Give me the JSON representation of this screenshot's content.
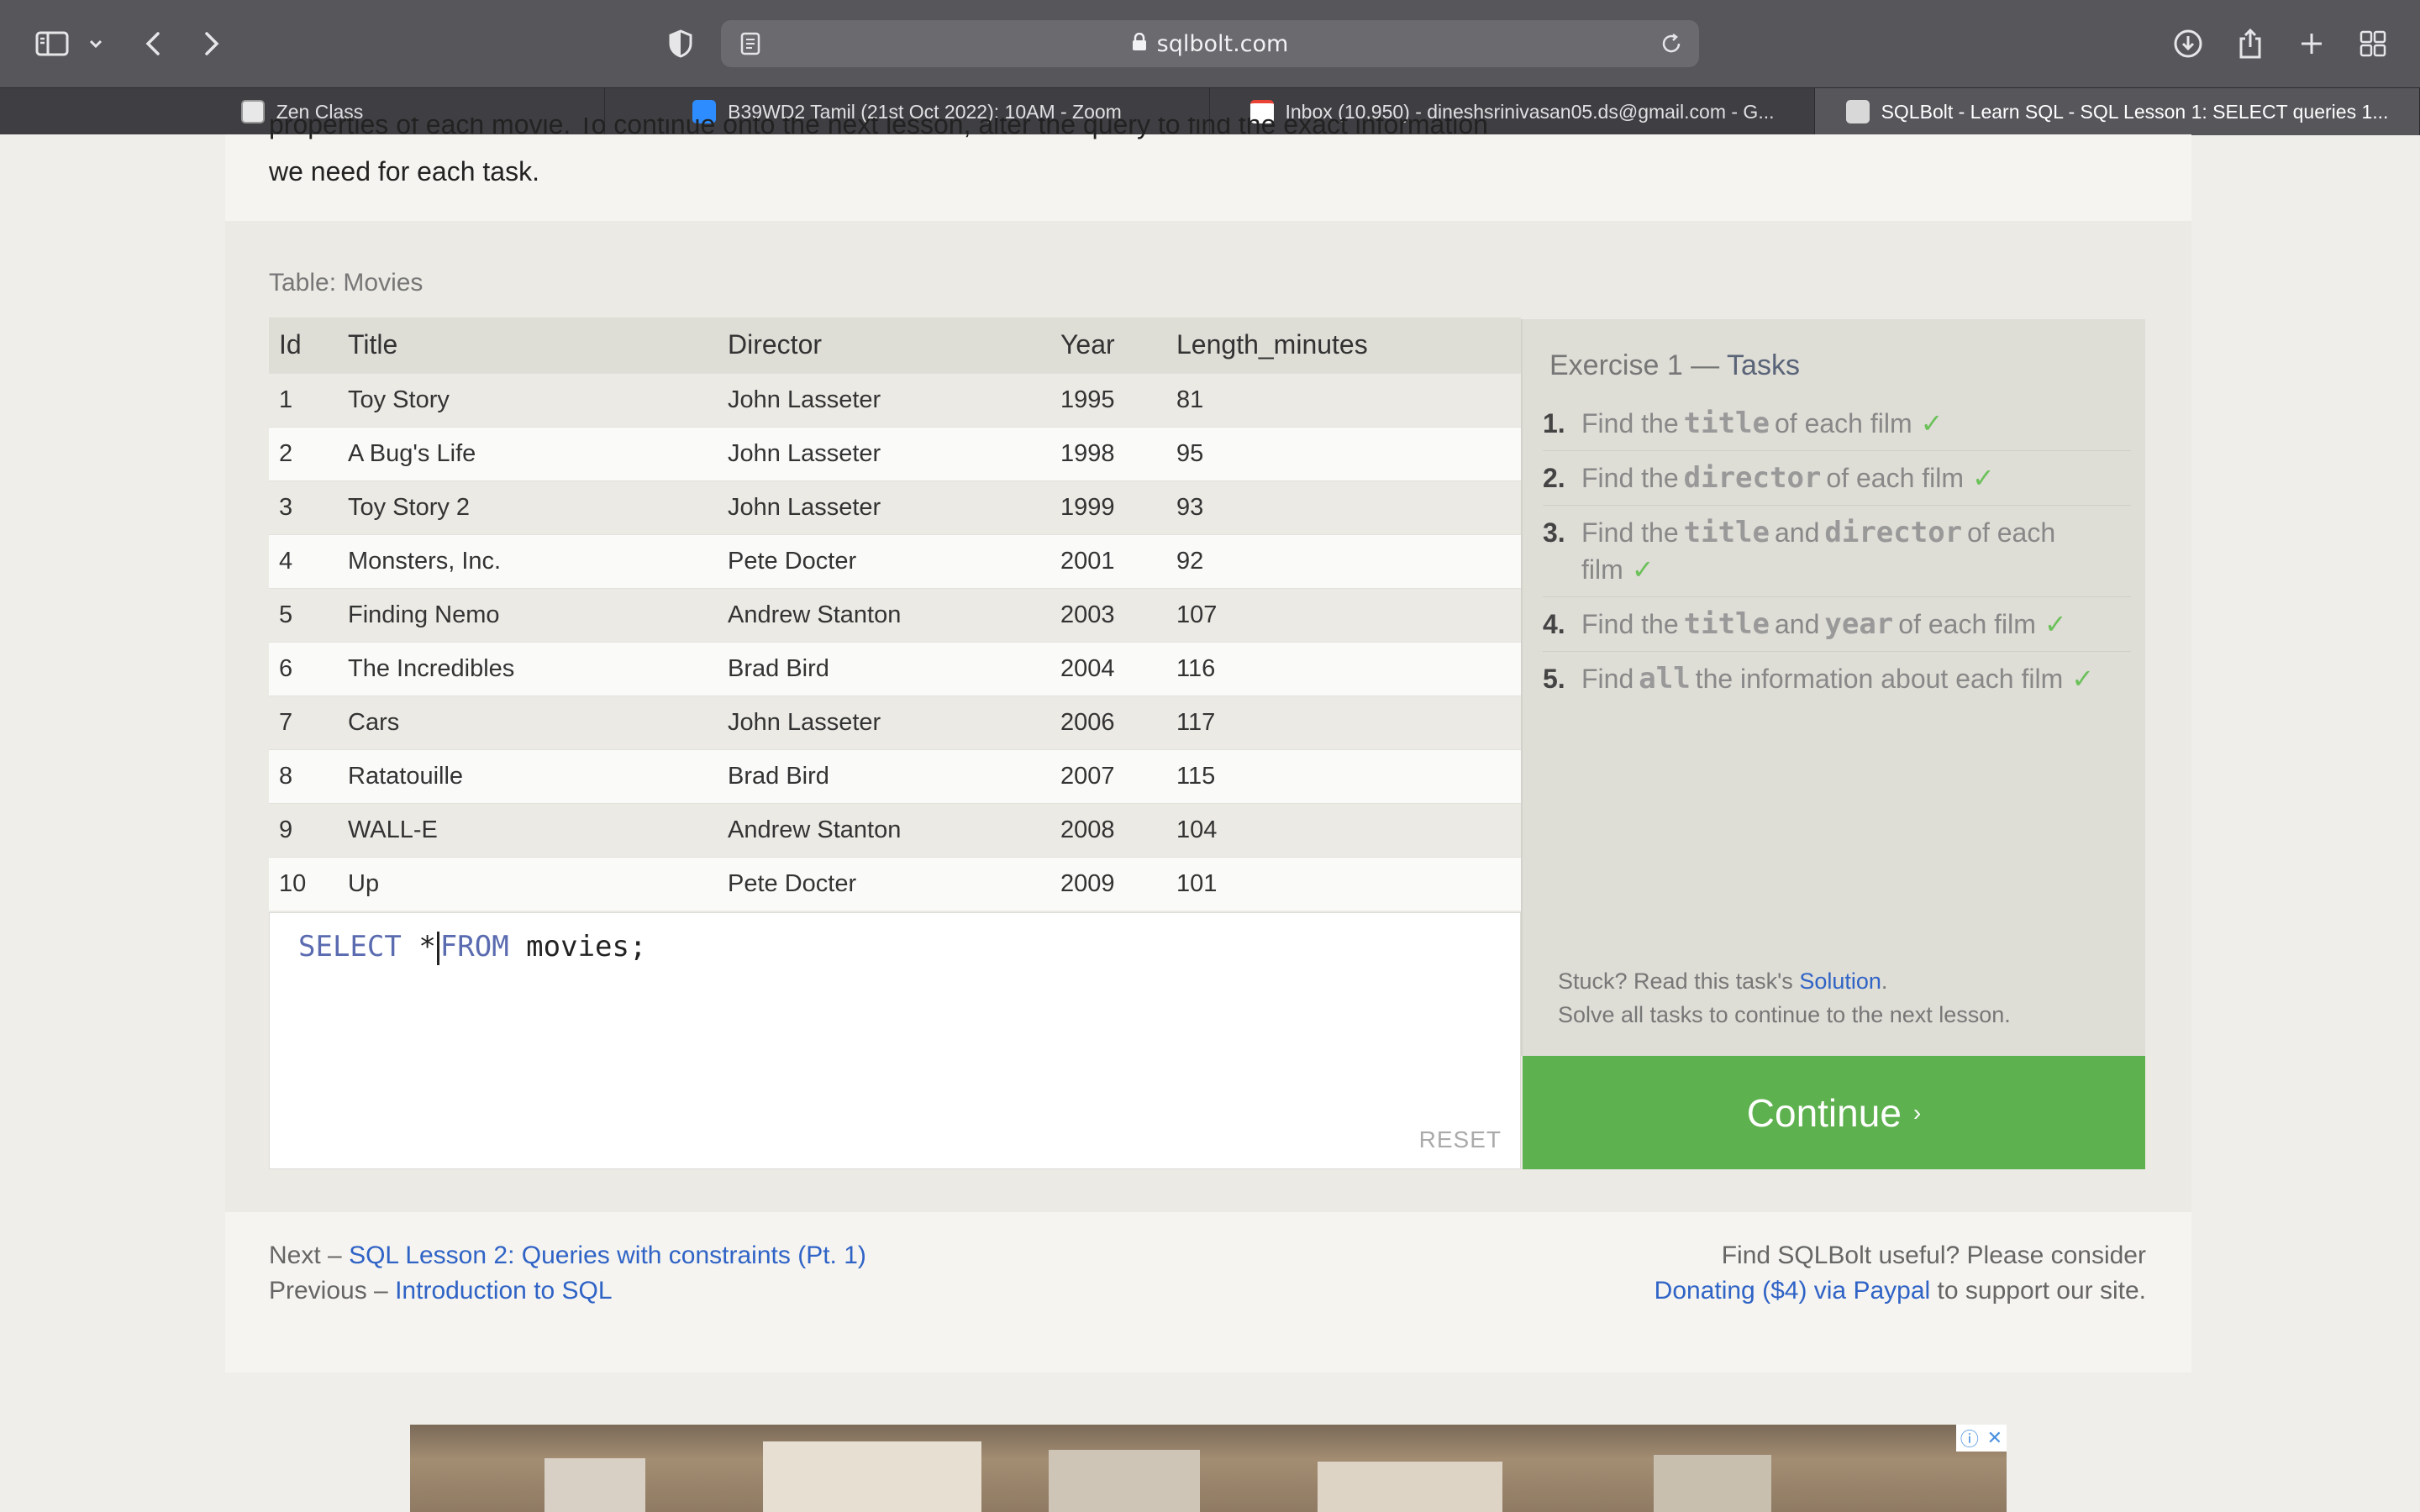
{
  "browser": {
    "url": "sqlbolt.com",
    "tabs": [
      {
        "label": "Zen Class",
        "icon": "zen-class-favicon"
      },
      {
        "label": "B39WD2 Tamil (21st Oct 2022): 10AM - Zoom",
        "icon": "zoom-favicon"
      },
      {
        "label": "Inbox (10,950) - dineshsrinivasan05.ds@gmail.com - G...",
        "icon": "gmail-favicon"
      },
      {
        "label": "SQLBolt - Learn SQL - SQL Lesson 1: SELECT queries 1...",
        "icon": "sqlbolt-favicon",
        "active": true
      }
    ]
  },
  "intro": {
    "clipped_line": "properties of each movie. To continue onto the next lesson, alter the query to find the exact information",
    "last_line": "we need for each task."
  },
  "table": {
    "caption": "Table: Movies",
    "columns": [
      "Id",
      "Title",
      "Director",
      "Year",
      "Length_minutes"
    ],
    "rows": [
      [
        "1",
        "Toy Story",
        "John Lasseter",
        "1995",
        "81"
      ],
      [
        "2",
        "A Bug's Life",
        "John Lasseter",
        "1998",
        "95"
      ],
      [
        "3",
        "Toy Story 2",
        "John Lasseter",
        "1999",
        "93"
      ],
      [
        "4",
        "Monsters, Inc.",
        "Pete Docter",
        "2001",
        "92"
      ],
      [
        "5",
        "Finding Nemo",
        "Andrew Stanton",
        "2003",
        "107"
      ],
      [
        "6",
        "The Incredibles",
        "Brad Bird",
        "2004",
        "116"
      ],
      [
        "7",
        "Cars",
        "John Lasseter",
        "2006",
        "117"
      ],
      [
        "8",
        "Ratatouille",
        "Brad Bird",
        "2007",
        "115"
      ],
      [
        "9",
        "WALL-E",
        "Andrew Stanton",
        "2008",
        "104"
      ],
      [
        "10",
        "Up",
        "Pete Docter",
        "2009",
        "101"
      ]
    ]
  },
  "editor": {
    "kw_select": "SELECT",
    "star": "*",
    "kw_from": "FROM",
    "rest": "movies;",
    "reset_label": "RESET"
  },
  "tasks": {
    "title_prefix": "Exercise 1 —",
    "title_suffix": "Tasks",
    "items": [
      {
        "num": "1.",
        "pre": "Find the",
        "code": "title",
        "post": "of each film",
        "done": true
      },
      {
        "num": "2.",
        "pre": "Find the",
        "code": "director",
        "post": "of each film",
        "done": true
      },
      {
        "num": "3.",
        "pre": "Find the",
        "code": "title",
        "mid": "and",
        "code2": "director",
        "post": "of each film",
        "done": true
      },
      {
        "num": "4.",
        "pre": "Find the",
        "code": "title",
        "mid": "and",
        "code2": "year",
        "post": "of each film",
        "done": true
      },
      {
        "num": "5.",
        "pre": "Find",
        "code": "all",
        "post": "the information about each film",
        "done": true
      }
    ],
    "check_mark": "✓",
    "stuck_text": "Stuck? Read this task's",
    "solution_link": "Solution",
    "solve_all_text": "Solve all tasks to continue to the next lesson.",
    "continue_label": "Continue",
    "continue_chevron": "›"
  },
  "footer": {
    "next_prefix": "Next –",
    "next_link": "SQL Lesson 2: Queries with constraints (Pt. 1)",
    "prev_prefix": "Previous –",
    "prev_link": "Introduction to SQL",
    "support_line1": "Find SQLBolt useful? Please consider",
    "donate_link": "Donating ($4) via Paypal",
    "support_tail": "to support our site."
  },
  "colors": {
    "continue_green": "#5db14e",
    "link_blue": "#2f63c6",
    "check_green": "#6cc15a"
  }
}
